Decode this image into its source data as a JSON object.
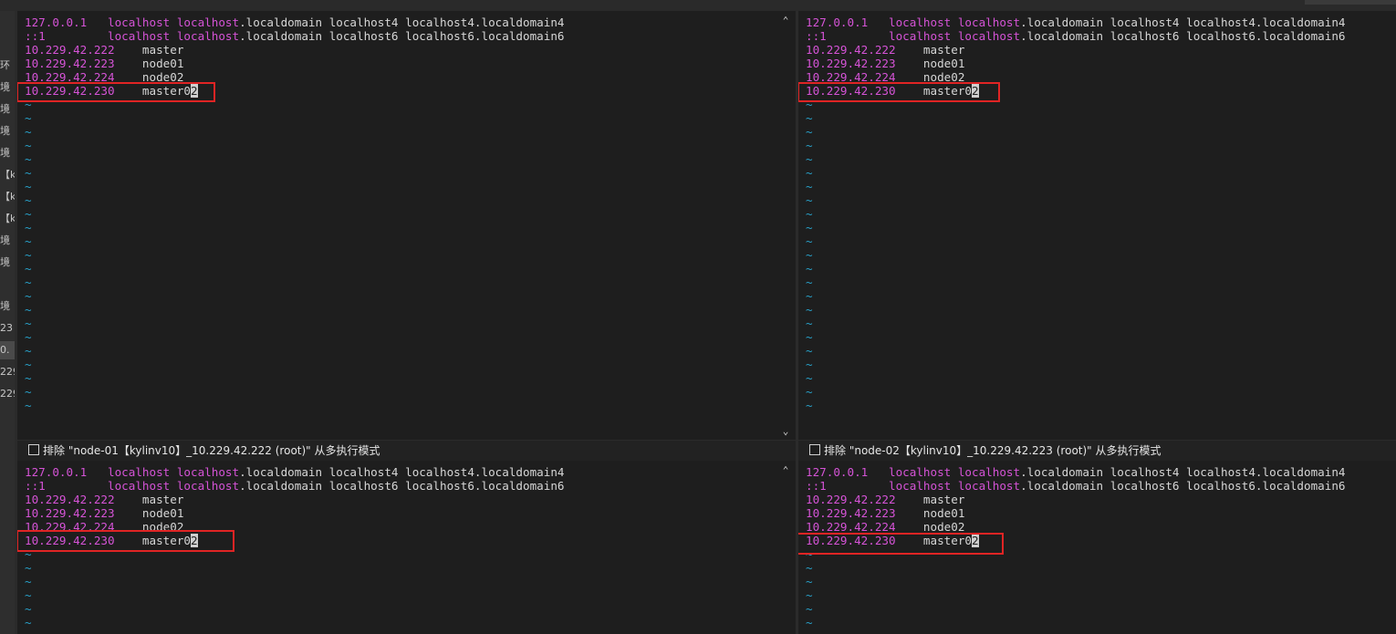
{
  "side_items": [
    "环",
    "境",
    "境",
    "境",
    "境",
    "【k",
    "【k",
    "【k",
    "境",
    "境",
    "境",
    "23",
    "0.",
    "229",
    "229"
  ],
  "panes": [
    {
      "id": "top-left",
      "lines": [
        {
          "ip": "127.0.0.1",
          "rest": "localhost localhost.localdomain localhost4 localhost4.localdomain4",
          "rest_color": "mixed"
        },
        {
          "ip": "::1",
          "rest": "localhost localhost.localdomain localhost6 localhost6.localdomain6",
          "rest_color": "mixed"
        },
        {
          "ip": "10.229.42.222",
          "rest": "master"
        },
        {
          "ip": "10.229.42.223",
          "rest": "node01"
        },
        {
          "ip": "10.229.42.224",
          "rest": "node02"
        },
        {
          "ip": "10.229.42.230",
          "rest": "master0",
          "cursor": "2"
        }
      ],
      "tilde_count": 23
    },
    {
      "id": "top-right",
      "lines": [
        {
          "ip": "127.0.0.1",
          "rest": "localhost localhost.localdomain localhost4 localhost4.localdomain4",
          "rest_color": "mixed"
        },
        {
          "ip": "::1",
          "rest": "localhost localhost.localdomain localhost6 localhost6.localdomain6",
          "rest_color": "mixed"
        },
        {
          "ip": "10.229.42.222",
          "rest": "master"
        },
        {
          "ip": "10.229.42.223",
          "rest": "node01"
        },
        {
          "ip": "10.229.42.224",
          "rest": "node02"
        },
        {
          "ip": "10.229.42.230",
          "rest": "master0",
          "cursor": "2"
        }
      ],
      "tilde_count": 23
    },
    {
      "id": "bottom-left",
      "lines": [
        {
          "ip": "127.0.0.1",
          "rest": "localhost localhost.localdomain localhost4 localhost4.localdomain4",
          "rest_color": "mixed"
        },
        {
          "ip": "::1",
          "rest": "localhost localhost.localdomain localhost6 localhost6.localdomain6",
          "rest_color": "mixed"
        },
        {
          "ip": "10.229.42.222",
          "rest": "master"
        },
        {
          "ip": "10.229.42.223",
          "rest": "node01"
        },
        {
          "ip": "10.229.42.224",
          "rest": "node02"
        },
        {
          "ip": "10.229.42.230",
          "rest": "master0",
          "cursor": "2"
        }
      ],
      "tilde_count": 6
    },
    {
      "id": "bottom-right",
      "lines": [
        {
          "ip": "127.0.0.1",
          "rest": "localhost localhost.localdomain localhost4 localhost4.localdomain4",
          "rest_color": "mixed"
        },
        {
          "ip": "::1",
          "rest": "localhost localhost.localdomain localhost6 localhost6.localdomain6",
          "rest_color": "mixed"
        },
        {
          "ip": "10.229.42.222",
          "rest": "master"
        },
        {
          "ip": "10.229.42.223",
          "rest": "node01"
        },
        {
          "ip": "10.229.42.224",
          "rest": "node02"
        },
        {
          "ip": "10.229.42.230",
          "rest": "master0",
          "cursor": "2"
        }
      ],
      "tilde_count": 6
    }
  ],
  "status_left": "排除 \"node-01【kylinv10】_10.229.42.222 (root)\" 从多执行模式",
  "status_right": "排除 \"node-02【kylinv10】_10.229.42.223 (root)\" 从多执行模式",
  "icons": {
    "scroll_up": "chevron-up-icon",
    "scroll_down": "chevron-down-icon",
    "checkbox": "checkbox-icon"
  },
  "colors": {
    "ip": "#d553d6",
    "text": "#d6d6d6",
    "tilde": "#28a0c8",
    "highlight": "#e02424",
    "background": "#1e1e1e"
  }
}
